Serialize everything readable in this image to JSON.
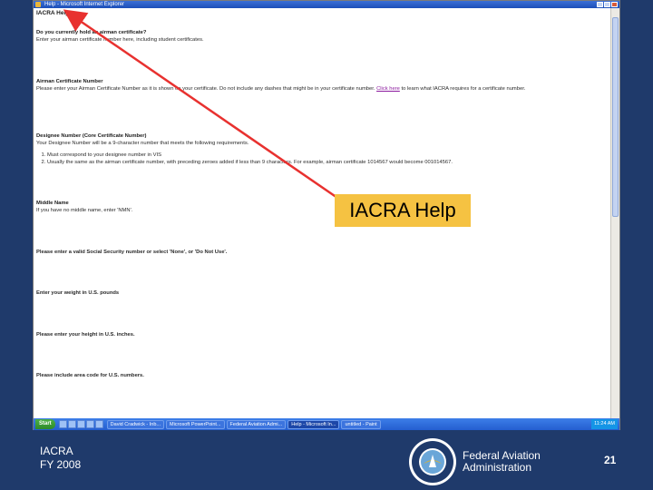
{
  "window": {
    "title": "Help - Microsoft Internet Explorer"
  },
  "document": {
    "title": "IACRA Help",
    "sections": [
      {
        "heading": "Do you currently hold an airman certificate?",
        "text": "Enter your airman certificate number here, including student certificates."
      },
      {
        "heading": "Airman Certificate Number",
        "text": "Please enter your Airman Certificate Number as it is shown on your certificate. Do not include any dashes that might be in your certificate number.",
        "link": "Click here",
        "text_after": "to learn what IACRA requires for a certificate number."
      },
      {
        "heading": "Designee Number (Core Certificate Number)",
        "text": "Your Designee Number will be a 9-character number that meets the following requirements.",
        "items": [
          "Must correspond to your designee number in VIS",
          "Usually the same as the airman certificate number, with preceding zeroes added if less than 9 characters. For example, airman certificate 1014567 would become 001014567."
        ]
      },
      {
        "heading": "Middle Name",
        "text": "If you have no middle name, enter 'NMN'."
      },
      {
        "heading": "",
        "text": "Please enter a valid Social Security number or select 'None', or 'Do Not Use'."
      },
      {
        "heading": "",
        "text": "Enter your weight in U.S. pounds"
      },
      {
        "heading": "",
        "text": "Please enter your height in U.S. inches."
      },
      {
        "heading": "",
        "text": "Please include area code for U.S. numbers."
      }
    ]
  },
  "taskbar": {
    "start_label": "Start",
    "items": [
      {
        "label": "David Cradwick - Inb..."
      },
      {
        "label": "Microsoft PowerPoint..."
      },
      {
        "label": "Federal Aviation Admi..."
      },
      {
        "label": "Help - Microsoft In...",
        "active": true
      },
      {
        "label": "untitled - Paint"
      }
    ],
    "clock": "11:24 AM"
  },
  "callout": {
    "label": "IACRA Help",
    "color": "#f5c242",
    "arrow_color": "#e8312f"
  },
  "footer": {
    "program": "IACRA",
    "year": "FY 2008",
    "agency_line1": "Federal Aviation",
    "agency_line2": "Administration",
    "page_number": "21"
  },
  "colors": {
    "slide_background": "#1f3a6b",
    "taskbar": "#245ed0"
  }
}
